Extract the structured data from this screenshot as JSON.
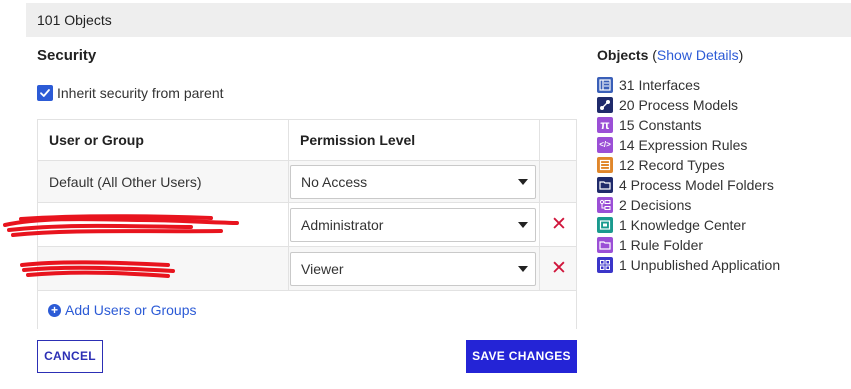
{
  "header": {
    "title": "101 Objects"
  },
  "security": {
    "title": "Security",
    "inherit_label": "Inherit security from parent",
    "inherit_checked": true,
    "table": {
      "headers": {
        "user": "User or Group",
        "permission": "Permission Level"
      },
      "rows": [
        {
          "user": "Default (All Other Users)",
          "permission": "No Access",
          "removable": false
        },
        {
          "user": "",
          "permission": "Administrator",
          "removable": true
        },
        {
          "user": "",
          "permission": "Viewer",
          "removable": true
        }
      ],
      "add_label": "Add Users or Groups"
    },
    "cancel_label": "CANCEL",
    "save_label": "SAVE CHANGES"
  },
  "objects": {
    "title": "Objects",
    "link_open": "(",
    "link_label": "Show Details",
    "link_close": ")",
    "items": [
      {
        "label": "31 Interfaces",
        "icon": "interface-icon",
        "color": "#3a5fb8"
      },
      {
        "label": "20 Process Models",
        "icon": "process-model-icon",
        "color": "#1f2a6b"
      },
      {
        "label": "15 Constants",
        "icon": "constant-icon",
        "color": "#9b4fd6"
      },
      {
        "label": "14 Expression Rules",
        "icon": "expression-rule-icon",
        "color": "#9b4fd6"
      },
      {
        "label": "12 Record Types",
        "icon": "record-type-icon",
        "color": "#e0862a"
      },
      {
        "label": "4 Process Model Folders",
        "icon": "process-model-folder-icon",
        "color": "#1f2a6b"
      },
      {
        "label": "2 Decisions",
        "icon": "decision-icon",
        "color": "#9b4fd6"
      },
      {
        "label": "1 Knowledge Center",
        "icon": "knowledge-center-icon",
        "color": "#1a9a8e"
      },
      {
        "label": "1 Rule Folder",
        "icon": "rule-folder-icon",
        "color": "#9b4fd6"
      },
      {
        "label": "1 Unpublished Application",
        "icon": "application-icon",
        "color": "#3b35c9"
      }
    ]
  },
  "colors": {
    "accent": "#2c5bd6",
    "primary_button": "#2424d6",
    "remove": "#d0153b",
    "redaction": "#e8141e"
  }
}
